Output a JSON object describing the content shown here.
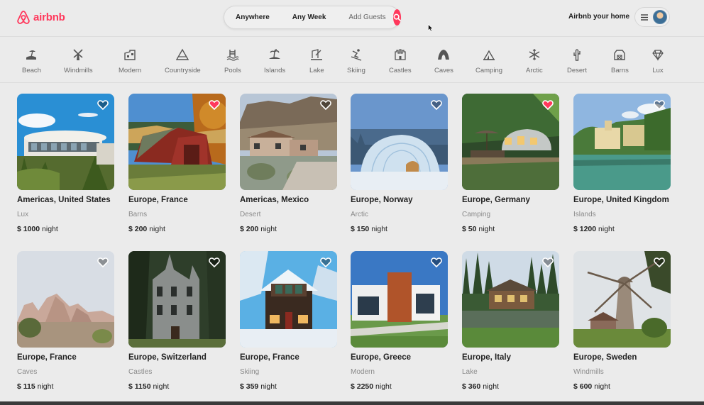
{
  "header": {
    "logo_text": "airbnb",
    "search": {
      "where": "Anywhere",
      "when": "Any Week",
      "who": "Add Guests"
    },
    "host_link": "Airbnb your home"
  },
  "categories": [
    {
      "label": "Beach",
      "icon": "beach-icon"
    },
    {
      "label": "Windmills",
      "icon": "windmill-icon"
    },
    {
      "label": "Modern",
      "icon": "modern-house-icon"
    },
    {
      "label": "Countryside",
      "icon": "countryside-icon"
    },
    {
      "label": "Pools",
      "icon": "pool-icon"
    },
    {
      "label": "Islands",
      "icon": "island-icon"
    },
    {
      "label": "Lake",
      "icon": "lake-icon"
    },
    {
      "label": "Skiing",
      "icon": "skiing-icon"
    },
    {
      "label": "Castles",
      "icon": "castle-icon"
    },
    {
      "label": "Caves",
      "icon": "cave-icon"
    },
    {
      "label": "Camping",
      "icon": "camping-icon"
    },
    {
      "label": "Arctic",
      "icon": "snowflake-icon"
    },
    {
      "label": "Desert",
      "icon": "cactus-icon"
    },
    {
      "label": "Barns",
      "icon": "barn-icon"
    },
    {
      "label": "Lux",
      "icon": "diamond-icon"
    }
  ],
  "listings": [
    {
      "location": "Americas, United States",
      "category": "Lux",
      "price": "$ 1000",
      "unit": "night",
      "favorited": false
    },
    {
      "location": "Europe, France",
      "category": "Barns",
      "price": "$ 200",
      "unit": "night",
      "favorited": true
    },
    {
      "location": "Americas, Mexico",
      "category": "Desert",
      "price": "$ 200",
      "unit": "night",
      "favorited": false
    },
    {
      "location": "Europe, Norway",
      "category": "Arctic",
      "price": "$ 150",
      "unit": "night",
      "favorited": false
    },
    {
      "location": "Europe, Germany",
      "category": "Camping",
      "price": "$ 50",
      "unit": "night",
      "favorited": true
    },
    {
      "location": "Europe, United Kingdom",
      "category": "Islands",
      "price": "$ 1200",
      "unit": "night",
      "favorited": false
    },
    {
      "location": "Europe, France",
      "category": "Caves",
      "price": "$ 115",
      "unit": "night",
      "favorited": false
    },
    {
      "location": "Europe, Switzerland",
      "category": "Castles",
      "price": "$ 1150",
      "unit": "night",
      "favorited": false
    },
    {
      "location": "Europe, France",
      "category": "Skiing",
      "price": "$ 359",
      "unit": "night",
      "favorited": false
    },
    {
      "location": "Europe, Greece",
      "category": "Modern",
      "price": "$ 2250",
      "unit": "night",
      "favorited": false
    },
    {
      "location": "Europe, Italy",
      "category": "Lake",
      "price": "$ 360",
      "unit": "night",
      "favorited": false
    },
    {
      "location": "Europe, Sweden",
      "category": "Windmills",
      "price": "$ 600",
      "unit": "night",
      "favorited": false
    }
  ],
  "colors": {
    "brand": "#ff385c",
    "background": "#ebebeb"
  }
}
